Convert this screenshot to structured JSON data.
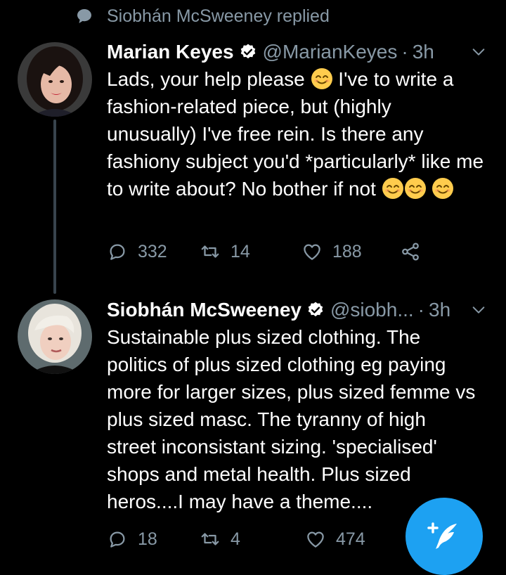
{
  "context": {
    "label": "Siobhán McSweeney replied"
  },
  "tweets": [
    {
      "name": "Marian Keyes",
      "handle": "@MarianKeyes",
      "separator": "·",
      "time": "3h",
      "text_parts": [
        "Lads, your help please ",
        " I've to write a fashion-related piece, but (highly unusually) I've free rein. Is there any fashiony subject you'd *particularly* like me to write about? No bother if not "
      ],
      "emojis": [
        "smiling-face-emoji",
        "smiling-face-emoji",
        "smiling-face-emoji",
        "smiling-face-emoji"
      ],
      "replies": "332",
      "retweets": "14",
      "likes": "188"
    },
    {
      "name": "Siobhán McSweeney",
      "handle": "@siobh...",
      "separator": "·",
      "time": "3h",
      "text": "Sustainable plus sized clothing. The politics of plus sized clothing eg paying more for larger sizes, plus sized femme vs plus sized masc. The tyranny of high street inconsistant sizing. 'specialised' shops and metal health. Plus sized heros....I may have a theme....",
      "replies": "18",
      "retweets": "4",
      "likes": "474"
    }
  ],
  "colors": {
    "background": "#000000",
    "secondary_text": "#8899a6",
    "accent": "#1da1f2",
    "thread_line": "#38444d"
  },
  "icons": [
    "speech-bubble-icon",
    "verified-badge-icon",
    "chevron-down-icon",
    "reply-icon",
    "retweet-icon",
    "like-icon",
    "share-icon",
    "compose-tweet-icon"
  ]
}
